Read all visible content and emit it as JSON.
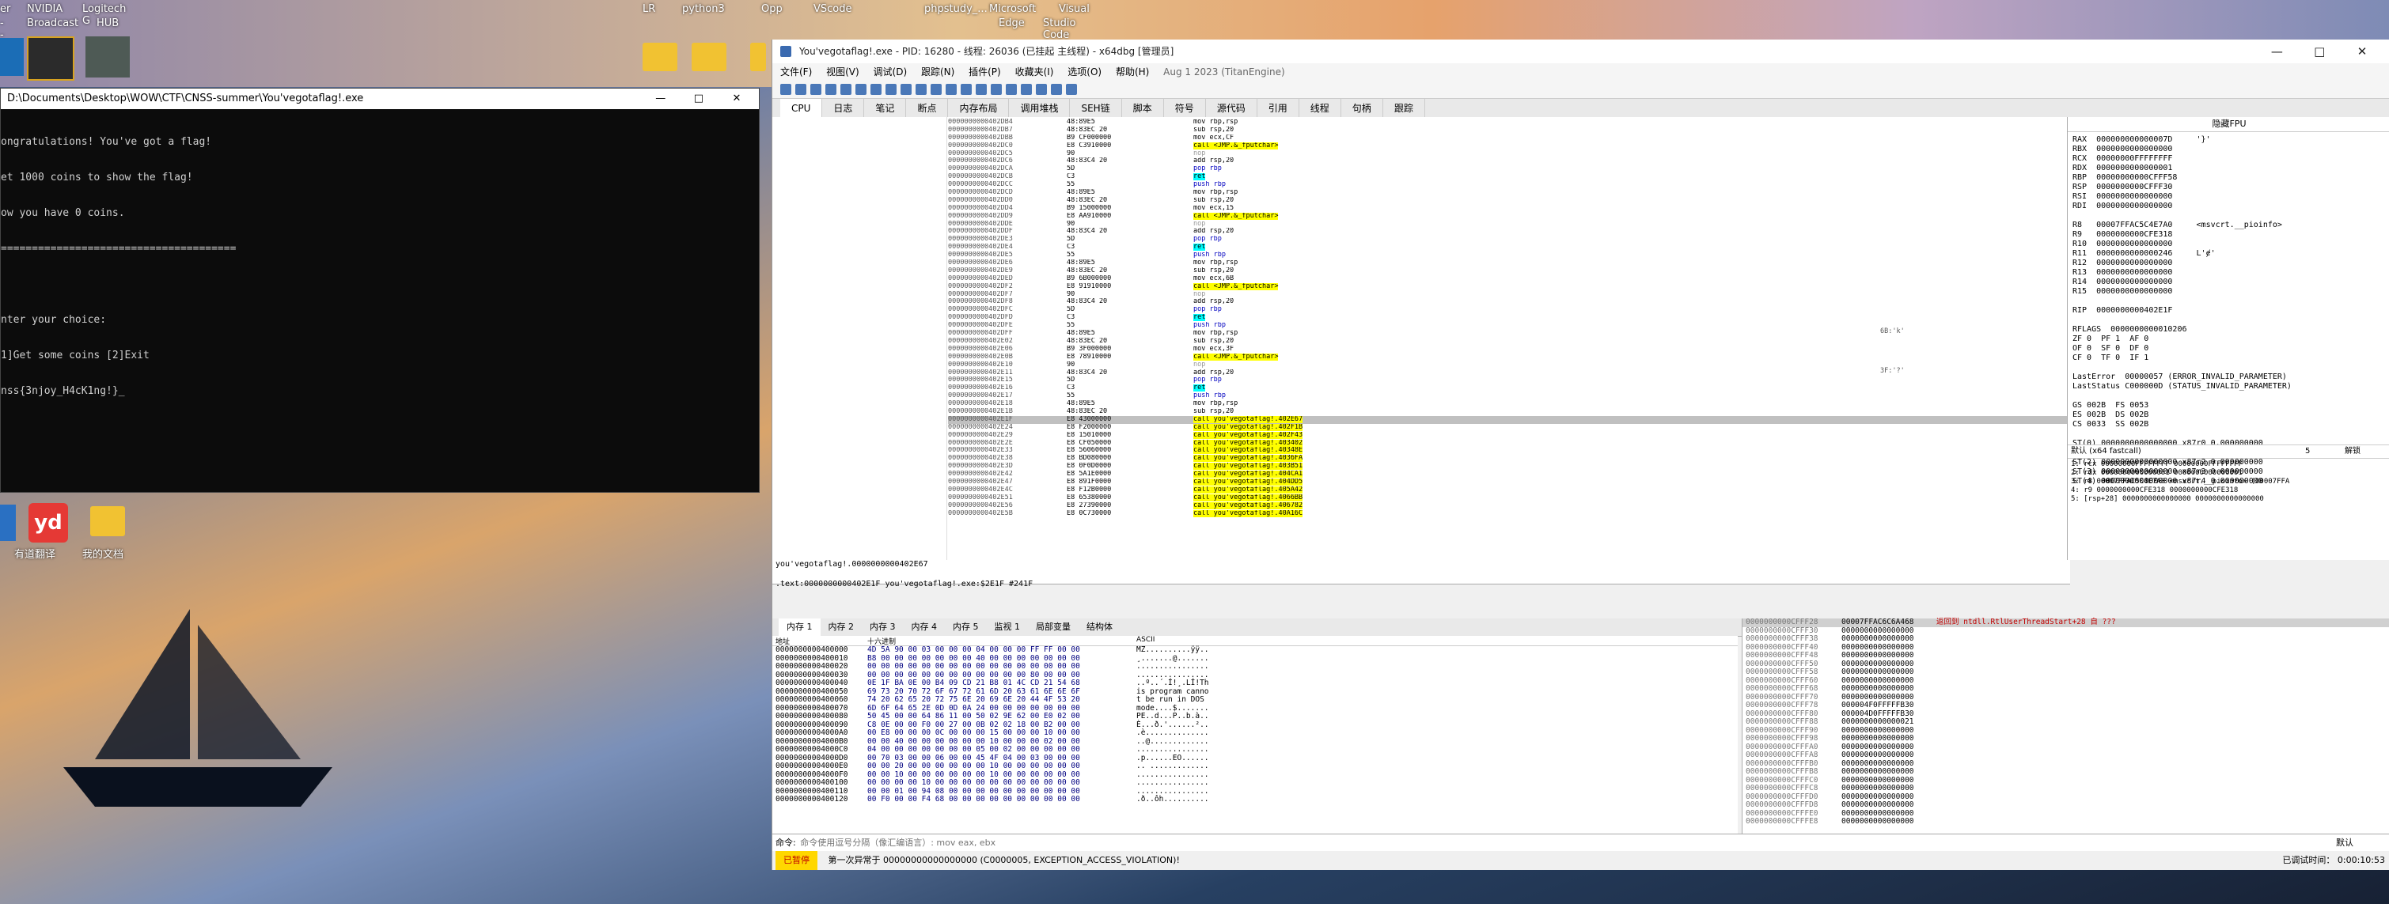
{
  "desktop": {
    "top_labels": [
      "er",
      "NVIDIA",
      "Logitech G",
      "LR",
      "python3",
      "Opp",
      "VScode",
      "phpstudy_...",
      "Microsoft",
      "Visual"
    ],
    "top_labels_line2": [
      "--",
      "Broadcast",
      "HUB",
      "Edge",
      "Studio Code"
    ],
    "left_icons": [
      "yd",
      "有道翻译",
      "我的文档"
    ]
  },
  "console": {
    "title": "D:\\Documents\\Desktop\\WOW\\CTF\\CNSS-summer\\You'vegotaflag!.exe",
    "lines": [
      "ongratulations! You've got a flag!",
      "et 1000 coins to show the flag!",
      "ow you have 0 coins.",
      "======================================",
      "",
      "nter your choice:",
      "1]Get some coins [2]Exit",
      "nss{3njoy_H4cK1ng!}_"
    ],
    "buttons": [
      "—",
      "□",
      "✕"
    ]
  },
  "dbg": {
    "title": "You'vegotaflag!.exe - PID: 16280 - 线程: 26036 (已挂起 主线程) - x64dbg [管理员]",
    "menu": [
      "文件(F)",
      "视图(V)",
      "调试(D)",
      "跟踪(N)",
      "插件(P)",
      "收藏夹(I)",
      "选项(O)",
      "帮助(H)",
      "Aug 1 2023 (TitanEngine)"
    ],
    "tabs": [
      "CPU",
      "日志",
      "笔记",
      "断点",
      "内存布局",
      "调用堆栈",
      "SEH链",
      "脚本",
      "符号",
      "源代码",
      "引用",
      "线程",
      "句柄",
      "跟踪"
    ],
    "disasm": [
      [
        "0000000000402DB4",
        "48:89E5",
        "mov rbp,rsp"
      ],
      [
        "0000000000402DB7",
        "48:83EC 20",
        "sub rsp,20"
      ],
      [
        "0000000000402DBB",
        "B9 CF000000",
        "mov ecx,CF"
      ],
      [
        "0000000000402DC0",
        "E8 C3910000",
        "call <JMP.&_fputchar>"
      ],
      [
        "0000000000402DC5",
        "90",
        "nop"
      ],
      [
        "0000000000402DC6",
        "48:83C4 20",
        "add rsp,20"
      ],
      [
        "0000000000402DCA",
        "5D",
        "pop rbp"
      ],
      [
        "0000000000402DCB",
        "C3",
        "ret"
      ],
      [
        "0000000000402DCC",
        "55",
        "push rbp"
      ],
      [
        "0000000000402DCD",
        "48:89E5",
        "mov rbp,rsp"
      ],
      [
        "0000000000402DD0",
        "48:83EC 20",
        "sub rsp,20"
      ],
      [
        "0000000000402DD4",
        "B9 15000000",
        "mov ecx,15"
      ],
      [
        "0000000000402DD9",
        "E8 AA910000",
        "call <JMP.&_fputchar>"
      ],
      [
        "0000000000402DDE",
        "90",
        "nop"
      ],
      [
        "0000000000402DDF",
        "48:83C4 20",
        "add rsp,20"
      ],
      [
        "0000000000402DE3",
        "5D",
        "pop rbp"
      ],
      [
        "0000000000402DE4",
        "C3",
        "ret"
      ],
      [
        "0000000000402DE5",
        "55",
        "push rbp"
      ],
      [
        "0000000000402DE6",
        "48:89E5",
        "mov rbp,rsp"
      ],
      [
        "0000000000402DE9",
        "48:83EC 20",
        "sub rsp,20"
      ],
      [
        "0000000000402DED",
        "B9 6B000000",
        "mov ecx,6B"
      ],
      [
        "0000000000402DF2",
        "E8 91910000",
        "call <JMP.&_fputchar>"
      ],
      [
        "0000000000402DF7",
        "90",
        "nop"
      ],
      [
        "0000000000402DF8",
        "48:83C4 20",
        "add rsp,20"
      ],
      [
        "0000000000402DFC",
        "5D",
        "pop rbp"
      ],
      [
        "0000000000402DFD",
        "C3",
        "ret"
      ],
      [
        "0000000000402DFE",
        "55",
        "push rbp"
      ],
      [
        "0000000000402DFF",
        "48:89E5",
        "mov rbp,rsp"
      ],
      [
        "0000000000402E02",
        "48:83EC 20",
        "sub rsp,20"
      ],
      [
        "0000000000402E06",
        "B9 3F000000",
        "mov ecx,3F"
      ],
      [
        "0000000000402E0B",
        "E8 78910000",
        "call <JMP.&_fputchar>"
      ],
      [
        "0000000000402E10",
        "90",
        "nop"
      ],
      [
        "0000000000402E11",
        "48:83C4 20",
        "add rsp,20"
      ],
      [
        "0000000000402E15",
        "5D",
        "pop rbp"
      ],
      [
        "0000000000402E16",
        "C3",
        "ret"
      ],
      [
        "0000000000402E17",
        "55",
        "push rbp"
      ],
      [
        "0000000000402E18",
        "48:89E5",
        "mov rbp,rsp"
      ],
      [
        "0000000000402E1B",
        "48:83EC 20",
        "sub rsp,20"
      ],
      [
        "0000000000402E1F",
        "E8 43000000",
        "call you'vegotaflag!.402E67"
      ],
      [
        "0000000000402E24",
        "E8 F2000000",
        "call you'vegotaflag!.402F1B"
      ],
      [
        "0000000000402E29",
        "E8 15010000",
        "call you'vegotaflag!.402F43"
      ],
      [
        "0000000000402E2E",
        "E8 CF050000",
        "call you'vegotaflag!.403402"
      ],
      [
        "0000000000402E33",
        "E8 56060000",
        "call you'vegotaflag!.40348E"
      ],
      [
        "0000000000402E38",
        "E8 BD080000",
        "call you'vegotaflag!.4036FA"
      ],
      [
        "0000000000402E3D",
        "E8 0F0D0000",
        "call you'vegotaflag!.403B51"
      ],
      [
        "0000000000402E42",
        "E8 5A1E0000",
        "call you'vegotaflag!.404CA1"
      ],
      [
        "0000000000402E47",
        "E8 891F0000",
        "call you'vegotaflag!.404DD5"
      ],
      [
        "0000000000402E4C",
        "E8 F12B0000",
        "call you'vegotaflag!.405A42"
      ],
      [
        "0000000000402E51",
        "E8 65380000",
        "call you'vegotaflag!.4066BB"
      ],
      [
        "0000000000402E56",
        "E8 27390000",
        "call you'vegotaflag!.406782"
      ],
      [
        "0000000000402E5B",
        "E8 0C730000",
        "call you'vegotaflag!.40A16C"
      ]
    ],
    "comments": [
      "6B:'k'",
      "3F:'?'"
    ],
    "info_line1": "you'vegotaflag!.0000000000402E67",
    "info_line2": ".text:0000000000402E1F you'vegotaflag!.exe:$2E1F #241F",
    "regs": {
      "title": "隐藏FPU",
      "lines": [
        "RAX  000000000000007D     '}'",
        "RBX  0000000000000000",
        "RCX  00000000FFFFFFFF",
        "RDX  0000000000000001",
        "RBP  00000000000CFFF58",
        "RSP  0000000000CFFF30",
        "RSI  0000000000000000",
        "RDI  0000000000000000",
        "",
        "R8   00007FFAC5C4E7A0     <msvcrt.__pioinfo>",
        "R9   0000000000CFE318",
        "R10  0000000000000000",
        "R11  0000000000000246     L'ɇ'",
        "R12  0000000000000000",
        "R13  0000000000000000",
        "R14  0000000000000000",
        "R15  0000000000000000",
        "",
        "RIP  0000000000402E1F",
        "",
        "RFLAGS  0000000000010206",
        "ZF 0  PF 1  AF 0",
        "OF 0  SF 0  DF 0",
        "CF 0  TF 0  IF 1",
        "",
        "LastError  00000057 (ERROR_INVALID_PARAMETER)",
        "LastStatus C000000D (STATUS_INVALID_PARAMETER)",
        "",
        "GS 002B  FS 0053",
        "ES 002B  DS 002B",
        "CS 0033  SS 002B",
        "",
        "ST(0) 0000000000000000 x87r0 0.000000000",
        "ST(1) 0000000000000000 x87r1 0.000000000",
        "ST(2) 0000000000000000 x87r2 0.000000000",
        "ST(3) 0000000000000000 x87r3 0.000000000",
        "ST(4) 0000000000000000 x87r4 0.000000000"
      ],
      "callconv": "默认 (x64 fastcall)",
      "callconv_count": "5",
      "unlock": "解锁",
      "args": [
        "1: rcx 00000000FFFFFFFF 00000000FFFFFFFF",
        "2: rdx 0000000000000001 0000000000000001",
        "3: r8 00007FFAC5C4E7A0 <msvcrt.__pioinfo> (00007FFA",
        "4: r9 0000000000CFE318 0000000000CFE318",
        "5: [rsp+28] 0000000000000000 0000000000000000"
      ]
    },
    "bottom_tabs": [
      "内存 1",
      "内存 2",
      "内存 3",
      "内存 4",
      "内存 5",
      "监视 1",
      "局部变量",
      "结构体"
    ],
    "dump_header": [
      "地址",
      "十六进制",
      "ASCII"
    ],
    "dump_rows": [
      [
        "0000000000400000",
        "4D 5A 90 00 03 00 00 00 04 00 00 00 FF FF 00 00",
        "MZ..........ÿÿ.."
      ],
      [
        "0000000000400010",
        "B8 00 00 00 00 00 00 00 40 00 00 00 00 00 00 00",
        "¸.......@......."
      ],
      [
        "0000000000400020",
        "00 00 00 00 00 00 00 00 00 00 00 00 00 00 00 00",
        "................"
      ],
      [
        "0000000000400030",
        "00 00 00 00 00 00 00 00 00 00 00 00 80 00 00 00",
        "................"
      ],
      [
        "0000000000400040",
        "0E 1F BA 0E 00 B4 09 CD 21 B8 01 4C CD 21 54 68",
        "..º..´.Í!¸.LÍ!Th"
      ],
      [
        "0000000000400050",
        "69 73 20 70 72 6F 67 72 61 6D 20 63 61 6E 6E 6F",
        "is program canno"
      ],
      [
        "0000000000400060",
        "74 20 62 65 20 72 75 6E 20 69 6E 20 44 4F 53 20",
        "t be run in DOS "
      ],
      [
        "0000000000400070",
        "6D 6F 64 65 2E 0D 0D 0A 24 00 00 00 00 00 00 00",
        "mode....$......."
      ],
      [
        "0000000000400080",
        "50 45 00 00 64 86 11 00 50 02 9E 62 00 E0 02 00",
        "PE..d...P..b.à.."
      ],
      [
        "0000000000400090",
        "C8 0E 00 00 F0 00 27 00 0B 02 02 18 00 B2 00 00",
        "È...ð.'......².."
      ],
      [
        "00000000004000A0",
        "00 E8 00 00 00 0C 00 00 00 15 00 00 00 10 00 00",
        ".è.............."
      ],
      [
        "00000000004000B0",
        "00 00 40 00 00 00 00 00 00 10 00 00 00 02 00 00",
        "..@............."
      ],
      [
        "00000000004000C0",
        "04 00 00 00 00 00 00 00 05 00 02 00 00 00 00 00",
        "................"
      ],
      [
        "00000000004000D0",
        "00 70 03 00 00 06 00 00 45 4F 04 00 03 00 00 00",
        ".p......EO......"
      ],
      [
        "00000000004000E0",
        "00 00 20 00 00 00 00 00 00 10 00 00 00 00 00 00",
        ".. ............."
      ],
      [
        "00000000004000F0",
        "00 00 10 00 00 00 00 00 00 10 00 00 00 00 00 00",
        "................"
      ],
      [
        "0000000000400100",
        "00 00 00 00 10 00 00 00 00 00 00 00 00 00 00 00",
        "................"
      ],
      [
        "0000000000400110",
        "00 00 01 00 94 08 00 00 00 00 00 00 00 00 00 00",
        "................"
      ],
      [
        "0000000000400120",
        "00 F0 00 00 F4 68 00 00 00 00 00 00 00 00 00 00",
        ".ð..ôh.........."
      ]
    ],
    "stack_rows": [
      [
        "0000000000CFFF28",
        "00007FFAC6C6A468",
        "返回到 ntdll.RtlUserThreadStart+28 自 ???"
      ],
      [
        "0000000000CFFF30",
        "0000000000000000",
        ""
      ],
      [
        "0000000000CFFF38",
        "0000000000000000",
        ""
      ],
      [
        "0000000000CFFF40",
        "0000000000000000",
        ""
      ],
      [
        "0000000000CFFF48",
        "0000000000000000",
        ""
      ],
      [
        "0000000000CFFF50",
        "0000000000000000",
        ""
      ],
      [
        "0000000000CFFF58",
        "0000000000000000",
        ""
      ],
      [
        "0000000000CFFF60",
        "0000000000000000",
        ""
      ],
      [
        "0000000000CFFF68",
        "0000000000000000",
        ""
      ],
      [
        "0000000000CFFF70",
        "0000000000000000",
        ""
      ],
      [
        "0000000000CFFF78",
        "000004F0FFFFFB30",
        ""
      ],
      [
        "0000000000CFFF80",
        "000004D0FFFFFB30",
        ""
      ],
      [
        "0000000000CFFF88",
        "0000000000000021",
        ""
      ],
      [
        "0000000000CFFF90",
        "0000000000000000",
        ""
      ],
      [
        "0000000000CFFF98",
        "0000000000000000",
        ""
      ],
      [
        "0000000000CFFFA0",
        "0000000000000000",
        ""
      ],
      [
        "0000000000CFFFA8",
        "0000000000000000",
        ""
      ],
      [
        "0000000000CFFFB0",
        "0000000000000000",
        ""
      ],
      [
        "0000000000CFFFB8",
        "0000000000000000",
        ""
      ],
      [
        "0000000000CFFFC0",
        "0000000000000000",
        ""
      ],
      [
        "0000000000CFFFC8",
        "0000000000000000",
        ""
      ],
      [
        "0000000000CFFFD0",
        "0000000000000000",
        ""
      ],
      [
        "0000000000CFFFD8",
        "0000000000000000",
        ""
      ],
      [
        "0000000000CFFFE0",
        "0000000000000000",
        ""
      ],
      [
        "0000000000CFFFE8",
        "0000000000000000",
        ""
      ]
    ],
    "cmd_label": "命令:",
    "cmd_placeholder": "命令使用逗号分隔（像汇编语言）: mov eax, ebx",
    "cmd_default": "默认",
    "status_paused": "已暂停",
    "status_text": "第一次异常于 00000000000000000 (C0000005, EXCEPTION_ACCESS_VIOLATION)!",
    "status_time": "已调试时间： 0:00:10:53",
    "colors": {
      "paused_bg": "#ffd700",
      "call_highlight": "#ffff00",
      "ret_highlight": "#00ffff",
      "reg_red": "#c00000",
      "selected_row": "#c0c0c0"
    }
  }
}
